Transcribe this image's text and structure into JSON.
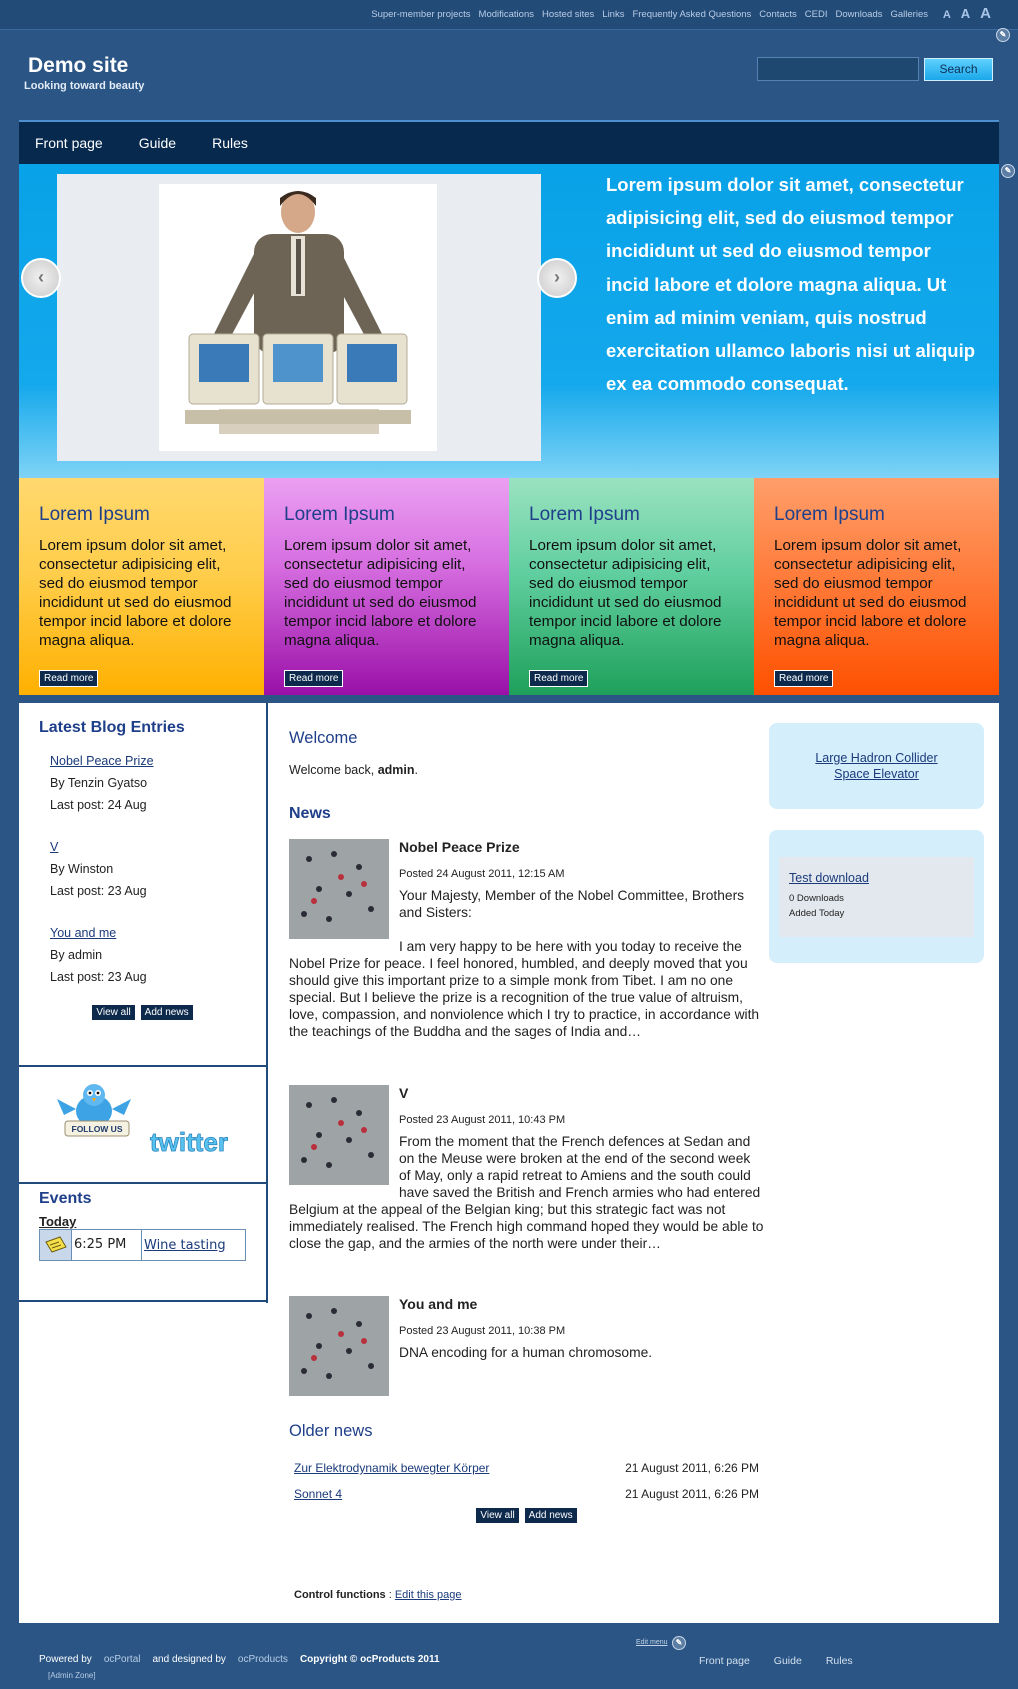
{
  "top_links": [
    "Super-member projects",
    "Modifications",
    "Hosted sites",
    "Links",
    "Frequently Asked Questions",
    "Contacts",
    "CEDI",
    "Downloads",
    "Galleries"
  ],
  "font_size_controls": [
    "A",
    "A",
    "A"
  ],
  "header": {
    "title": "Demo site",
    "subtitle": "Looking toward beauty"
  },
  "search": {
    "button_label": "Search",
    "value": ""
  },
  "main_nav": [
    "Front page",
    "Guide",
    "Rules"
  ],
  "hero": {
    "text": "Lorem ipsum dolor sit amet, consectetur adipisicing elit, sed do eiusmod tempor incididunt ut sed do eiusmod tempor incid labore et dolore magna aliqua. Ut enim ad minim veniam, quis nostrud exercitation ullamco laboris nisi ut aliquip ex ea commodo consequat."
  },
  "feature_boxes": [
    {
      "title": "Lorem Ipsum",
      "body": "Lorem ipsum dolor sit amet, consectetur adipisicing elit, sed do eiusmod tempor incididunt ut sed do eiusmod tempor incid labore et dolore magna aliqua.",
      "button": "Read more",
      "color": "#ffb000"
    },
    {
      "title": "Lorem Ipsum",
      "body": "Lorem ipsum dolor sit amet, consectetur adipisicing elit, sed do eiusmod tempor incididunt ut sed do eiusmod tempor incid labore et dolore magna aliqua.",
      "button": "Read more",
      "color": "#9a10a8"
    },
    {
      "title": "Lorem Ipsum",
      "body": "Lorem ipsum dolor sit amet, consectetur adipisicing elit, sed do eiusmod tempor incididunt ut sed do eiusmod tempor incid labore et dolore magna aliqua.",
      "button": "Read more",
      "color": "#1ea05a"
    },
    {
      "title": "Lorem Ipsum",
      "body": "Lorem ipsum dolor sit amet, consectetur adipisicing elit, sed do eiusmod tempor incididunt ut sed do eiusmod tempor incid labore et dolore magna aliqua.",
      "button": "Read more",
      "color": "#ff5000"
    }
  ],
  "blog": {
    "heading": "Latest Blog Entries",
    "entries": [
      {
        "title": "Nobel Peace Prize",
        "by": "By Tenzin Gyatso",
        "last": "Last post: 24 Aug"
      },
      {
        "title": "V",
        "by": "By Winston",
        "last": "Last post: 23 Aug"
      },
      {
        "title": "You and me",
        "by": "By admin",
        "last": "Last post: 23 Aug"
      }
    ],
    "view_all": "View all",
    "add_news": "Add news"
  },
  "twitter": {
    "follow_text": "FOLLOW US",
    "logo_text": "twitter"
  },
  "events": {
    "heading": "Events",
    "today_label": "Today",
    "items": [
      {
        "time": "6:25 PM",
        "title": "Wine tasting"
      }
    ]
  },
  "welcome": {
    "heading": "Welcome",
    "prefix": "Welcome back, ",
    "user": "admin",
    "suffix": "."
  },
  "news": {
    "heading": "News",
    "items": [
      {
        "title": "Nobel Peace Prize",
        "posted": "Posted 24 August 2011, 12:15 AM",
        "lead": "Your Majesty, Member of the Nobel Committee, Brothers and Sisters:",
        "body": "I am very happy to be here with you today to receive the Nobel Prize for peace. I feel honored, humbled, and deeply moved that you should give this important prize to a simple monk from Tibet. I am no one special. But I believe the prize is a recognition of the true value of altruism, love, compassion, and nonviolence which I try to practice, in accordance with the teachings of the Buddha and the sages of India and…"
      },
      {
        "title": "V",
        "posted": "Posted 23 August 2011, 10:43 PM",
        "lead": "",
        "body": "From the moment that the French defences at Sedan and on the Meuse were broken at the end of the second week of May, only a rapid retreat to Amiens and the south could have saved the British and French armies who had entered Belgium at the appeal of the Belgian king; but this strategic fact was not immediately realised. The French high command hoped they would be able to close the gap, and the armies of the north were under their…"
      },
      {
        "title": "You and me",
        "posted": "Posted 23 August 2011, 10:38 PM",
        "lead": "",
        "body": "DNA encoding for a human chromosome."
      }
    ]
  },
  "older_news": {
    "heading": "Older news",
    "items": [
      {
        "title": "Zur Elektrodynamik bewegter Körper",
        "date": "21 August 2011, 6:26 PM"
      },
      {
        "title": "Sonnet 4",
        "date": "21 August 2011, 6:26 PM"
      }
    ],
    "view_all": "View all",
    "add_news": "Add news"
  },
  "control": {
    "label": "Control functions",
    "sep": " : ",
    "link": "Edit this page"
  },
  "side_links": [
    "Large Hadron Collider",
    "Space Elevator"
  ],
  "downloads": {
    "title": "Test download",
    "count": "0 Downloads",
    "added": "Added Today"
  },
  "footer": {
    "powered_by": "Powered by",
    "oc_portal": "ocPortal",
    "designed_by": "and designed by",
    "oc_products": "ocProducts",
    "copyright": "Copyright © ocProducts 2011",
    "admin_zone": "[Admin Zone]",
    "edit_menu": "Edit menu",
    "nav": [
      "Front page",
      "Guide",
      "Rules"
    ]
  },
  "colors": {
    "page_bg": "#2a5585",
    "nav_bg": "#07294e",
    "hero_bg": "#08a2e8",
    "heading": "#1f3f8a"
  }
}
